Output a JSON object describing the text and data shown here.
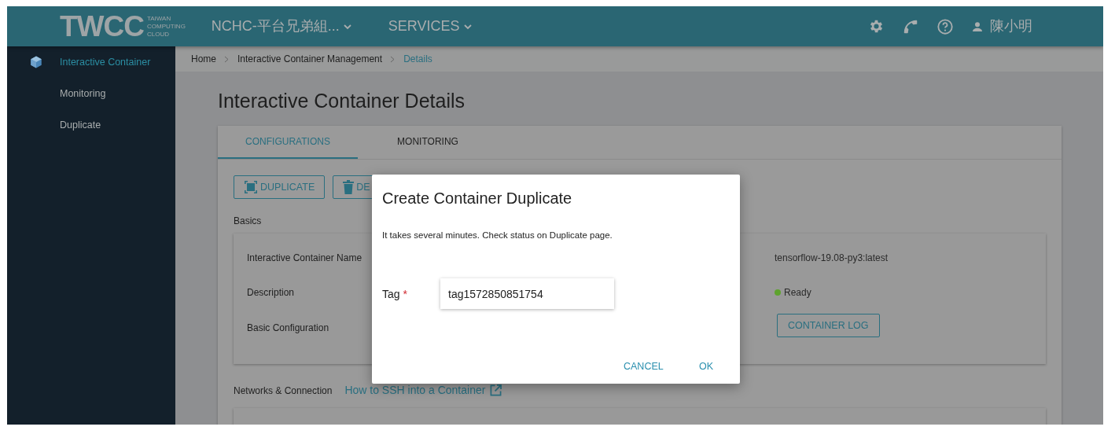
{
  "header": {
    "logo": {
      "mark": "TWCC",
      "subtitle": [
        "TAIWAN",
        "COMPUTING",
        "CLOUD"
      ]
    },
    "project_menu": "NCHC-平台兄弟組...",
    "services_menu": "SERVICES",
    "user_name": "陳小明"
  },
  "sidebar": {
    "items": [
      {
        "label": "Interactive Container",
        "selected": true
      },
      {
        "label": "Monitoring",
        "selected": false
      },
      {
        "label": "Duplicate",
        "selected": false
      }
    ]
  },
  "breadcrumb": [
    {
      "label": "Home",
      "current": false
    },
    {
      "label": "Interactive Container Management",
      "current": false
    },
    {
      "label": "Details",
      "current": true
    }
  ],
  "page_title": "Interactive Container Details",
  "tabs": [
    {
      "label": "CONFIGURATIONS",
      "selected": true
    },
    {
      "label": "MONITORING",
      "selected": false
    }
  ],
  "actions": [
    {
      "label": "DUPLICATE",
      "kind": "duplicate"
    },
    {
      "label": "DE",
      "kind": "delete"
    }
  ],
  "basics": {
    "heading": "Basics",
    "labels": [
      "Interactive Container Name",
      "Description",
      "Basic Configuration"
    ],
    "values": [
      {
        "kind": "text",
        "text": "tensorflow-19.08-py3:latest"
      },
      {
        "kind": "status",
        "text": "Ready",
        "color": "#5ea32e"
      },
      {
        "kind": "button",
        "text": "CONTAINER LOG"
      }
    ]
  },
  "networks": {
    "heading": "Networks & Connection",
    "help_link": "How to SSH into a Container"
  },
  "dialog": {
    "title": "Create Container Duplicate",
    "message": "It takes several minutes. Check status on Duplicate page.",
    "field": {
      "label": "Tag",
      "required_mark": "*",
      "value": "tag1572850851754"
    },
    "buttons": [
      "CANCEL",
      "OK"
    ]
  }
}
